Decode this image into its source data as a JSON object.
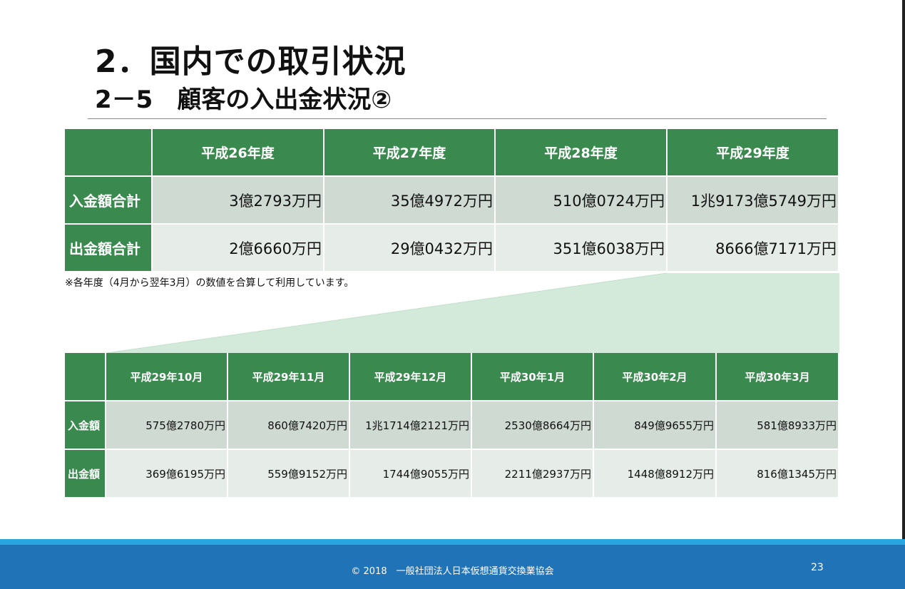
{
  "title": "2．国内での取引状況",
  "subtitle": "2－5　顧客の入出金状況②",
  "table1": {
    "headers": [
      "",
      "平成26年度",
      "平成27年度",
      "平成28年度",
      "平成29年度"
    ],
    "rows": [
      {
        "label": "入金額合計",
        "values": [
          "3億2793万円",
          "35億4972万円",
          "510億0724万円",
          "1兆9173億5749万円"
        ]
      },
      {
        "label": "出金額合計",
        "values": [
          "2億6660万円",
          "29億0432万円",
          "351億6038万円",
          "8666億7171万円"
        ]
      }
    ]
  },
  "note": "※各年度（4月から翌年3月）の数値を合算して利用しています。",
  "table2": {
    "headers": [
      "",
      "平成29年10月",
      "平成29年11月",
      "平成29年12月",
      "平成30年1月",
      "平成30年2月",
      "平成30年3月"
    ],
    "rows": [
      {
        "label": "入金額",
        "values": [
          "575億2780万円",
          "860億7420万円",
          "1兆1714億2121万円",
          "2530億8664万円",
          "849億9655万円",
          "581億8933万円"
        ]
      },
      {
        "label": "出金額",
        "values": [
          "369億6195万円",
          "559億9152万円",
          "1744億9055万円",
          "2211億2937万円",
          "1448億8912万円",
          "816億1345万円"
        ]
      }
    ]
  },
  "footer": {
    "copyright": "© 2018　一般社団法人日本仮想通貨交換業協会",
    "page_number": "23"
  },
  "colors": {
    "header_green": "#3a8a4f",
    "row_light": "#cfdad3",
    "row_lighter": "#e6ece7",
    "zoom_fill": "#d3e9da",
    "footer_blue": "#2173b8",
    "footer_stripe": "#29a6df"
  }
}
